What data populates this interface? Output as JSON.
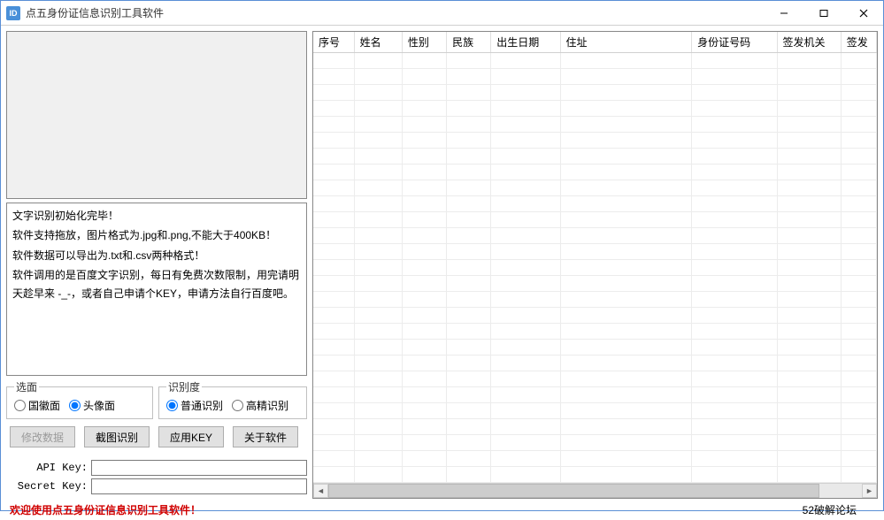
{
  "window": {
    "title": "点五身份证信息识别工具软件",
    "icon_text": "ID"
  },
  "log": {
    "line1": "文字识别初始化完毕！",
    "line2": "软件支持拖放，图片格式为.jpg和.png,不能大于400KB！",
    "line3": "软件数据可以导出为.txt和.csv两种格式！",
    "line4": "软件调用的是百度文字识别，每日有免费次数限制，用完请明天趁早来 -_-，或者自己申请个KEY，申请方法自行百度吧。"
  },
  "groups": {
    "side": {
      "legend": "选面",
      "opt1": "国徽面",
      "opt2": "头像面",
      "selected": "opt2"
    },
    "precision": {
      "legend": "识别度",
      "opt1": "普通识别",
      "opt2": "高精识别",
      "selected": "opt1"
    }
  },
  "buttons": {
    "edit_data": "修改数据",
    "screenshot_ocr": "截图识别",
    "apply_key": "应用KEY",
    "about": "关于软件"
  },
  "keys": {
    "api_label": "API Key:",
    "secret_label": "Secret Key:",
    "api_value": "",
    "secret_value": ""
  },
  "table": {
    "columns": [
      "序号",
      "姓名",
      "性别",
      "民族",
      "出生日期",
      "住址",
      "身份证号码",
      "签发机关",
      "签发"
    ],
    "widths": [
      46,
      54,
      50,
      50,
      78,
      148,
      96,
      72,
      40
    ]
  },
  "status": {
    "left": "欢迎使用点五身份证信息识别工具软件！",
    "right": "52破解论坛"
  }
}
